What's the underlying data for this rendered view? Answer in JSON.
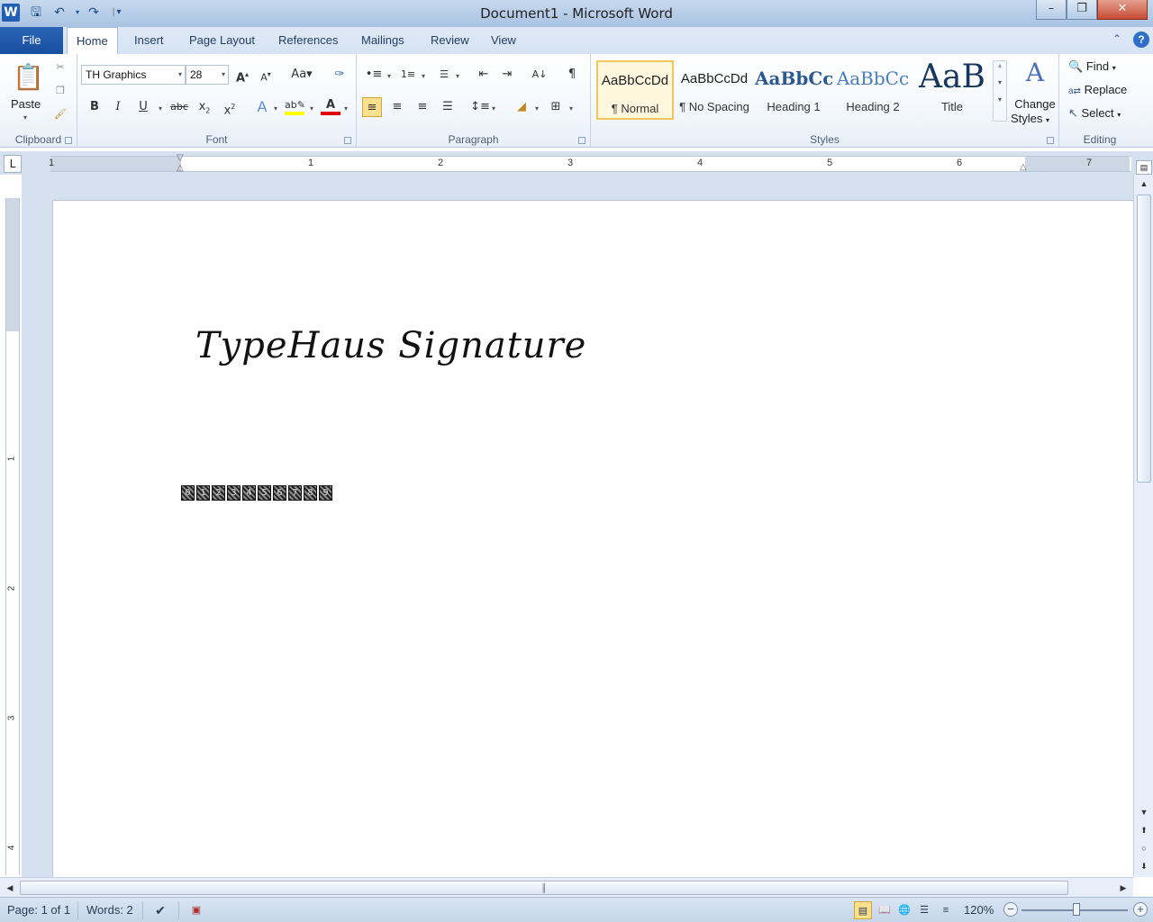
{
  "window": {
    "title": "Document1 - Microsoft Word",
    "minimize_icon": "minimize-icon",
    "restore_icon": "restore-icon",
    "close_icon": "close-icon"
  },
  "tabs": {
    "file": "File",
    "items": [
      "Home",
      "Insert",
      "Page Layout",
      "References",
      "Mailings",
      "Review",
      "View"
    ],
    "active": "Home"
  },
  "ribbon": {
    "clipboard": {
      "label": "Clipboard",
      "paste": "Paste"
    },
    "font": {
      "label": "Font",
      "name": "TH Graphics",
      "size": "28"
    },
    "paragraph": {
      "label": "Paragraph"
    },
    "styles": {
      "label": "Styles",
      "items": [
        {
          "sample": "AaBbCcDd",
          "name": "¶ Normal"
        },
        {
          "sample": "AaBbCcDd",
          "name": "¶ No Spacing"
        },
        {
          "sample": "AaBbCc",
          "name": "Heading 1"
        },
        {
          "sample": "AaBbCc",
          "name": "Heading 2"
        },
        {
          "sample": "AaB",
          "name": "Title"
        }
      ],
      "change_styles_line1": "Change",
      "change_styles_line2": "Styles"
    },
    "editing": {
      "label": "Editing",
      "find": "Find",
      "replace": "Replace",
      "select": "Select"
    }
  },
  "ruler": {
    "numbers": [
      "1",
      "1",
      "2",
      "3",
      "4",
      "5",
      "6",
      "7"
    ],
    "vertical_numbers": [
      "1",
      "2",
      "3",
      "4"
    ],
    "tab_selector": "L"
  },
  "document": {
    "signature_text": "TypeHaus Signature",
    "glyph_row": [
      "0",
      "1",
      "2",
      "3",
      "4",
      "5",
      "6",
      "7",
      "8",
      "9"
    ]
  },
  "statusbar": {
    "page": "Page: 1 of 1",
    "words": "Words: 2",
    "zoom": "120%",
    "zoom_level_percent": 120
  },
  "colors": {
    "file_tab": "#1a4e9e",
    "selected_style_border": "#f2c65b",
    "highlight_yellow": "#ffff00",
    "font_color_red": "#e00000"
  }
}
